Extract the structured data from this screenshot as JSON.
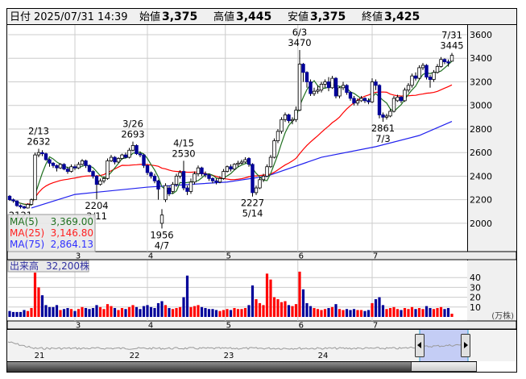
{
  "header": {
    "date_label": "日付",
    "datetime": "2025/07/31 14:39",
    "open_label": "始値",
    "open": "3,375",
    "high_label": "高値",
    "high": "3,445",
    "low_label": "安値",
    "low": "3,375",
    "close_label": "終値",
    "close": "3,425"
  },
  "legend": {
    "ma5_label": "MA(5)",
    "ma5_value": "3,369.00",
    "ma25_label": "MA(25)",
    "ma25_value": "3,146.80",
    "ma75_label": "MA(75)",
    "ma75_value": "2,864.13"
  },
  "volume_panel": {
    "label": "出来高",
    "value": "32,200株",
    "unit": "(万株)"
  },
  "colors": {
    "up_fill": "#ffffff",
    "down_fill": "#000099",
    "vol_up": "#ff0000",
    "vol_down": "#000099",
    "vol_flat": "#888888",
    "ma5": "#207020",
    "ma25": "#ff0000",
    "ma75": "#2020ee",
    "high_text": "#ff0000",
    "low_text": "#007000"
  },
  "chart_data": {
    "type": "candlestick",
    "price_axis": {
      "ticks": [
        "3600",
        "3400",
        "3200",
        "3000",
        "2800",
        "2600",
        "2400",
        "2200",
        "2000"
      ],
      "range": [
        1900,
        3700
      ]
    },
    "volume_axis": {
      "ticks": [
        "40",
        "30",
        "20",
        "10"
      ],
      "unit": "万株"
    },
    "months": [
      {
        "label": "3",
        "idx": 18
      },
      {
        "label": "4",
        "idx": 38
      },
      {
        "label": "5",
        "idx": 59.5
      },
      {
        "label": "6",
        "idx": 79.5
      },
      {
        "label": "7",
        "idx": 100
      }
    ],
    "candles": [
      [
        2230,
        2240,
        2190,
        2200,
        6
      ],
      [
        2200,
        2210,
        2175,
        2190,
        5
      ],
      [
        2190,
        2195,
        2140,
        2150,
        5
      ],
      [
        2150,
        2160,
        2125,
        2140,
        5
      ],
      [
        2140,
        2150,
        2121,
        2130,
        7
      ],
      [
        2130,
        2170,
        2125,
        2160,
        6
      ],
      [
        2160,
        2210,
        2150,
        2200,
        9
      ],
      [
        2200,
        2600,
        2200,
        2580,
        45
      ],
      [
        2580,
        2632,
        2560,
        2600,
        30
      ],
      [
        2600,
        2620,
        2570,
        2590,
        22
      ],
      [
        2590,
        2600,
        2530,
        2540,
        12
      ],
      [
        2540,
        2550,
        2480,
        2510,
        10
      ],
      [
        2510,
        2520,
        2470,
        2490,
        10
      ],
      [
        2490,
        2500,
        2440,
        2470,
        12
      ],
      [
        2470,
        2510,
        2460,
        2500,
        7
      ],
      [
        2500,
        2510,
        2450,
        2460,
        8
      ],
      [
        2460,
        2480,
        2420,
        2440,
        9
      ],
      [
        2440,
        2500,
        2430,
        2480,
        8
      ],
      [
        2480,
        2500,
        2450,
        2470,
        6
      ],
      [
        2470,
        2520,
        2460,
        2500,
        8
      ],
      [
        2500,
        2545,
        2490,
        2530,
        10
      ],
      [
        2530,
        2540,
        2470,
        2490,
        9
      ],
      [
        2490,
        2500,
        2430,
        2440,
        8
      ],
      [
        2440,
        2450,
        2380,
        2400,
        9
      ],
      [
        2400,
        2410,
        2204,
        2330,
        12
      ],
      [
        2330,
        2380,
        2320,
        2360,
        10
      ],
      [
        2360,
        2400,
        2340,
        2380,
        8
      ],
      [
        2380,
        2550,
        2370,
        2530,
        13
      ],
      [
        2530,
        2580,
        2520,
        2560,
        11
      ],
      [
        2560,
        2570,
        2500,
        2520,
        9
      ],
      [
        2520,
        2560,
        2510,
        2550,
        7
      ],
      [
        2550,
        2590,
        2540,
        2580,
        9
      ],
      [
        2580,
        2600,
        2550,
        2560,
        8
      ],
      [
        2560,
        2640,
        2550,
        2620,
        10
      ],
      [
        2620,
        2693,
        2610,
        2660,
        12
      ],
      [
        2660,
        2670,
        2580,
        2590,
        10
      ],
      [
        2590,
        2610,
        2560,
        2580,
        8
      ],
      [
        2580,
        2590,
        2470,
        2490,
        11
      ],
      [
        2490,
        2500,
        2410,
        2430,
        12
      ],
      [
        2430,
        2440,
        2380,
        2400,
        10
      ],
      [
        2400,
        2420,
        2340,
        2360,
        9
      ],
      [
        2360,
        2370,
        2200,
        2290,
        14
      ],
      [
        2000,
        2120,
        1956,
        2070,
        16
      ],
      [
        2200,
        2340,
        2180,
        2320,
        12
      ],
      [
        2300,
        2320,
        2230,
        2250,
        9
      ],
      [
        2270,
        2350,
        2250,
        2330,
        8
      ],
      [
        2330,
        2420,
        2310,
        2400,
        9
      ],
      [
        2400,
        2450,
        2380,
        2430,
        10
      ],
      [
        2440,
        2530,
        2280,
        2300,
        20
      ],
      [
        2300,
        2320,
        2240,
        2270,
        42
      ],
      [
        2270,
        2380,
        2250,
        2350,
        10
      ],
      [
        2350,
        2440,
        2330,
        2420,
        11
      ],
      [
        2420,
        2490,
        2400,
        2470,
        12
      ],
      [
        2470,
        2480,
        2400,
        2420,
        10
      ],
      [
        2420,
        2440,
        2390,
        2410,
        9
      ],
      [
        2410,
        2420,
        2360,
        2380,
        8
      ],
      [
        2380,
        2390,
        2340,
        2360,
        8
      ],
      [
        2360,
        2380,
        2330,
        2350,
        7
      ],
      [
        2350,
        2400,
        2340,
        2380,
        6
      ],
      [
        2380,
        2460,
        2370,
        2440,
        7
      ],
      [
        2440,
        2490,
        2430,
        2480,
        8
      ],
      [
        2480,
        2500,
        2440,
        2460,
        7
      ],
      [
        2460,
        2510,
        2450,
        2500,
        9
      ],
      [
        2500,
        2530,
        2480,
        2510,
        8
      ],
      [
        2510,
        2540,
        2500,
        2520,
        8
      ],
      [
        2520,
        2560,
        2510,
        2540,
        9
      ],
      [
        2550,
        2560,
        2480,
        2500,
        12
      ],
      [
        2500,
        2510,
        2227,
        2260,
        32
      ],
      [
        2260,
        2320,
        2240,
        2300,
        18
      ],
      [
        2300,
        2390,
        2290,
        2370,
        14
      ],
      [
        2370,
        2420,
        2350,
        2400,
        12
      ],
      [
        2400,
        2500,
        2390,
        2480,
        44
      ],
      [
        2480,
        2580,
        2470,
        2560,
        38
      ],
      [
        2560,
        2720,
        2550,
        2700,
        20
      ],
      [
        2700,
        2800,
        2680,
        2780,
        18
      ],
      [
        2780,
        2900,
        2760,
        2880,
        15
      ],
      [
        2880,
        2940,
        2860,
        2920,
        16
      ],
      [
        2920,
        2930,
        2850,
        2870,
        12
      ],
      [
        2870,
        2900,
        2840,
        2880,
        11
      ],
      [
        2880,
        2990,
        2860,
        2960,
        13
      ],
      [
        2960,
        3470,
        2950,
        3350,
        46
      ],
      [
        3350,
        3360,
        3200,
        3280,
        28
      ],
      [
        3280,
        3290,
        3150,
        3200,
        14
      ],
      [
        3200,
        3220,
        3080,
        3100,
        11
      ],
      [
        3100,
        3150,
        3080,
        3120,
        9
      ],
      [
        3120,
        3170,
        3100,
        3130,
        8
      ],
      [
        3130,
        3200,
        3110,
        3180,
        7
      ],
      [
        3180,
        3220,
        3150,
        3200,
        8
      ],
      [
        3200,
        3240,
        3120,
        3150,
        9
      ],
      [
        3150,
        3250,
        3140,
        3230,
        10
      ],
      [
        3230,
        3240,
        3060,
        3080,
        13
      ],
      [
        3080,
        3160,
        3060,
        3150,
        8
      ],
      [
        3150,
        3200,
        3130,
        3170,
        7
      ],
      [
        3170,
        3180,
        3090,
        3110,
        8
      ],
      [
        3110,
        3120,
        3040,
        3060,
        7
      ],
      [
        3060,
        3080,
        3000,
        3020,
        8
      ],
      [
        3020,
        3060,
        3000,
        3040,
        7
      ],
      [
        3040,
        3080,
        3030,
        3060,
        7
      ],
      [
        3060,
        3070,
        3020,
        3040,
        6
      ],
      [
        3040,
        3060,
        3010,
        3030,
        7
      ],
      [
        3030,
        3230,
        3020,
        3200,
        14
      ],
      [
        3200,
        3220,
        3130,
        3170,
        18
      ],
      [
        3170,
        3180,
        2890,
        2920,
        20
      ],
      [
        2920,
        2940,
        2861,
        2900,
        12
      ],
      [
        2900,
        2930,
        2880,
        2910,
        8
      ],
      [
        2910,
        2970,
        2900,
        2950,
        9
      ],
      [
        2950,
        3080,
        2940,
        3060,
        10
      ],
      [
        3040,
        3090,
        3030,
        3070,
        8
      ],
      [
        3070,
        3080,
        3020,
        3040,
        7
      ],
      [
        3040,
        3150,
        3030,
        3130,
        9
      ],
      [
        3130,
        3190,
        3110,
        3170,
        8
      ],
      [
        3170,
        3270,
        3150,
        3250,
        10
      ],
      [
        3250,
        3280,
        3210,
        3230,
        8
      ],
      [
        3230,
        3340,
        3220,
        3320,
        9
      ],
      [
        3320,
        3360,
        3300,
        3340,
        8
      ],
      [
        3340,
        3350,
        3220,
        3240,
        11
      ],
      [
        3240,
        3260,
        3150,
        3220,
        9
      ],
      [
        3220,
        3300,
        3200,
        3280,
        8
      ],
      [
        3280,
        3350,
        3270,
        3330,
        9
      ],
      [
        3330,
        3410,
        3320,
        3390,
        10
      ],
      [
        3390,
        3400,
        3350,
        3370,
        8
      ],
      [
        3370,
        3390,
        3330,
        3360,
        9
      ],
      [
        3375,
        3445,
        3375,
        3425,
        3.22
      ]
    ],
    "ma75": [
      [
        6,
        2130
      ],
      [
        18,
        2245
      ],
      [
        38,
        2307
      ],
      [
        60,
        2350
      ],
      [
        71,
        2400
      ],
      [
        86,
        2560
      ],
      [
        101,
        2650
      ],
      [
        113,
        2745
      ],
      [
        122,
        2864
      ]
    ],
    "annotations": [
      {
        "idx": 8,
        "price": 2632,
        "pos": "above",
        "line1": "2/13",
        "line2": "2632"
      },
      {
        "idx": 34,
        "price": 2693,
        "pos": "above",
        "line1": "3/26",
        "line2": "2693"
      },
      {
        "idx": 48,
        "price": 2530,
        "pos": "above",
        "line1": "4/15",
        "line2": "2530"
      },
      {
        "idx": 80,
        "price": 3470,
        "pos": "above",
        "line1": "6/3",
        "line2": "3470"
      },
      {
        "idx": 122,
        "price": 3445,
        "pos": "above",
        "line1": "7/31",
        "line2": "3445"
      },
      {
        "idx": 3,
        "price": 2121,
        "pos": "below",
        "line1": "2121",
        "line2": ""
      },
      {
        "idx": 24,
        "price": 2204,
        "pos": "below",
        "line1": "2204",
        "line2": "3/11"
      },
      {
        "idx": 42,
        "price": 1956,
        "pos": "below",
        "line1": "1956",
        "line2": "4/7"
      },
      {
        "idx": 67,
        "price": 2227,
        "pos": "below",
        "line1": "2227",
        "line2": "5/14"
      },
      {
        "idx": 103,
        "price": 2861,
        "pos": "below",
        "line1": "2861",
        "line2": "7/3"
      }
    ]
  },
  "navigator": {
    "year_labels": [
      "21",
      "22",
      "23",
      "24"
    ]
  }
}
